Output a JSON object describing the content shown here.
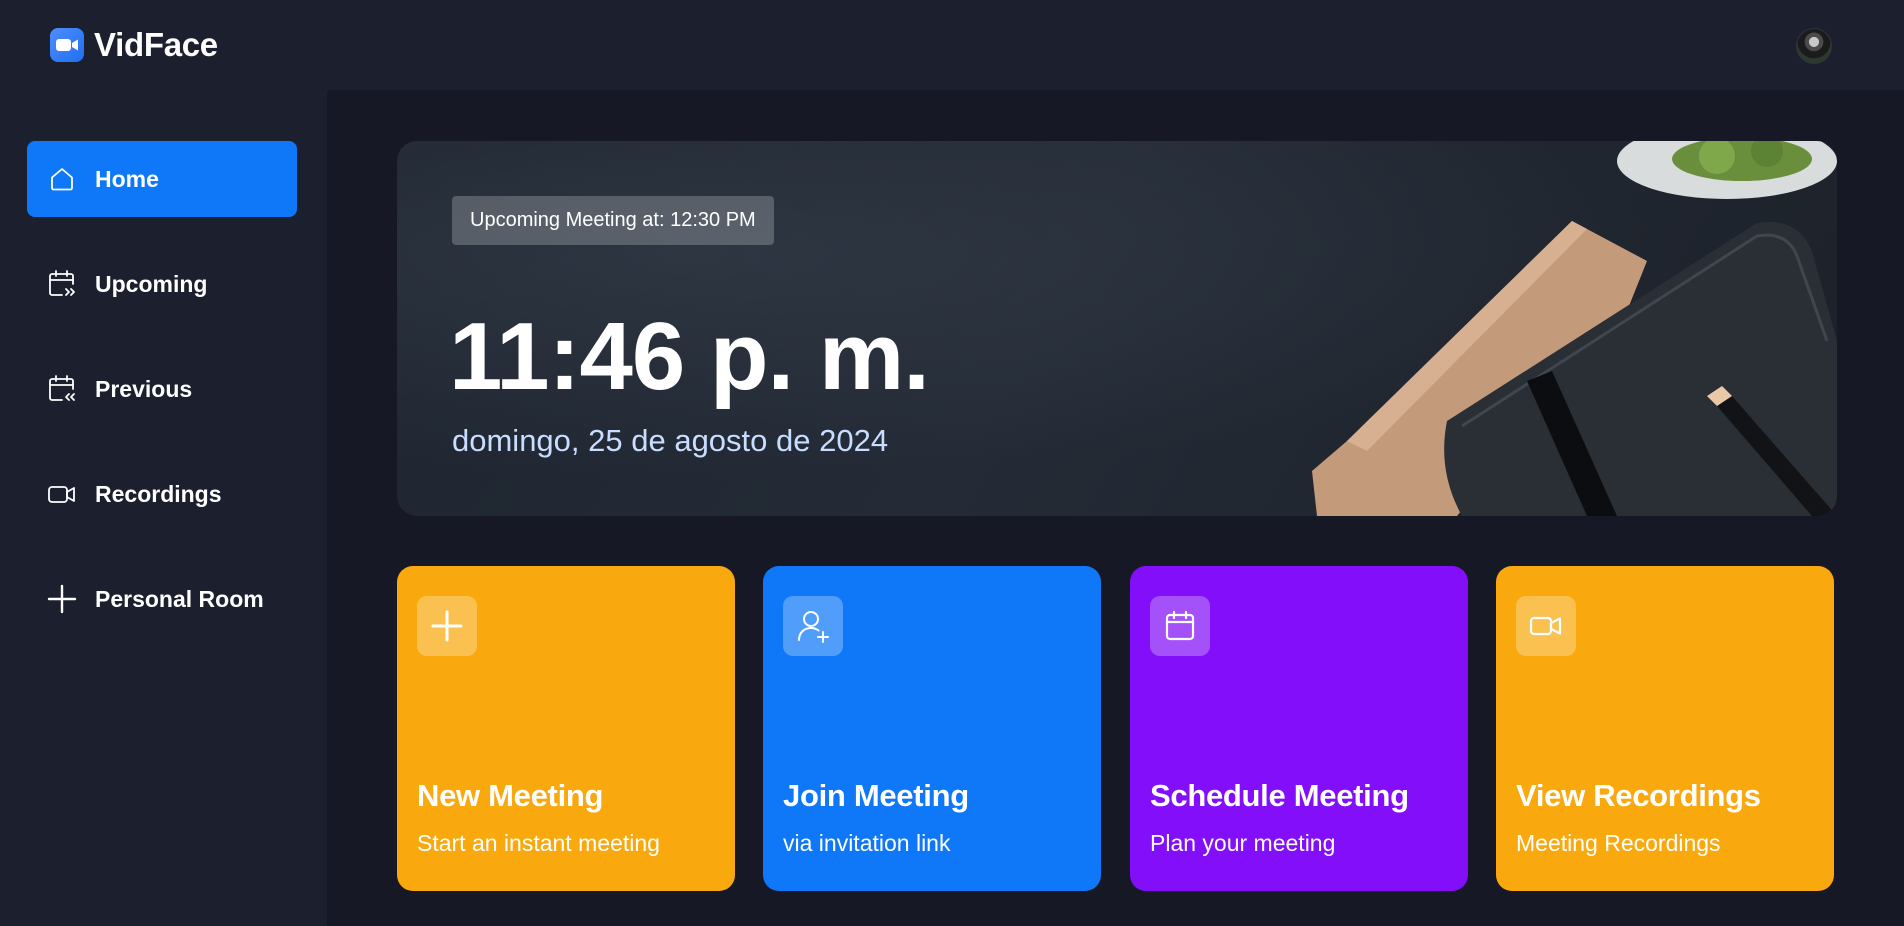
{
  "app": {
    "name": "VidFace"
  },
  "colors": {
    "accent_blue": "#0e78f9",
    "orange": "#f9a90e",
    "purple": "#830ef9",
    "sidebar_bg": "#1c1f2e",
    "page_bg": "#161925"
  },
  "sidebar": {
    "items": [
      {
        "label": "Home",
        "icon": "home-icon",
        "active": true
      },
      {
        "label": "Upcoming",
        "icon": "calendar-forward-icon",
        "active": false
      },
      {
        "label": "Previous",
        "icon": "calendar-back-icon",
        "active": false
      },
      {
        "label": "Recordings",
        "icon": "video-icon",
        "active": false
      },
      {
        "label": "Personal Room",
        "icon": "plus-icon",
        "active": false
      }
    ]
  },
  "hero": {
    "badge": "Upcoming Meeting at: 12:30 PM",
    "time": "11:46 p. m.",
    "date": "domingo, 25 de agosto de 2024"
  },
  "cards": [
    {
      "title": "New Meeting",
      "subtitle": "Start an instant meeting",
      "icon": "plus-icon",
      "color": "#f9a90e"
    },
    {
      "title": "Join Meeting",
      "subtitle": "via invitation link",
      "icon": "user-plus-icon",
      "color": "#0e78f9"
    },
    {
      "title": "Schedule Meeting",
      "subtitle": "Plan your meeting",
      "icon": "calendar-icon",
      "color": "#830ef9"
    },
    {
      "title": "View Recordings",
      "subtitle": "Meeting Recordings",
      "icon": "video-icon",
      "color": "#f9a90e"
    }
  ]
}
